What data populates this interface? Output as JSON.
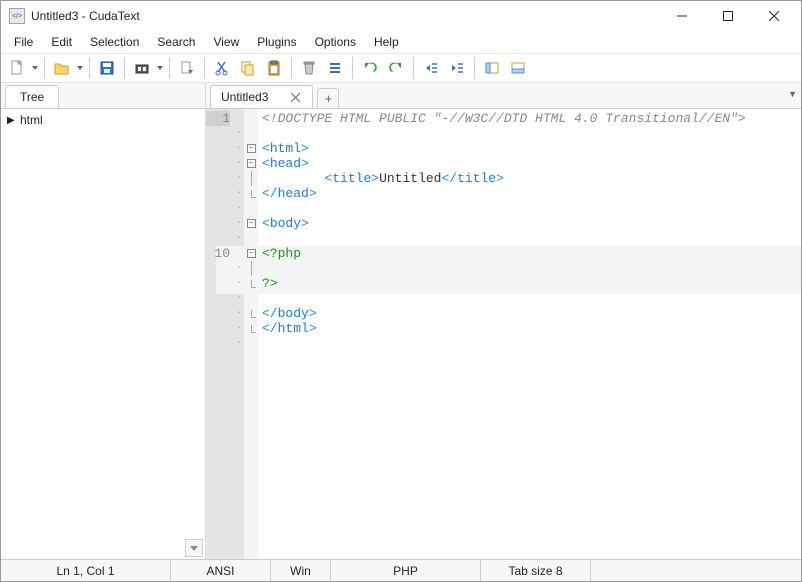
{
  "window": {
    "title": "Untitled3 - CudaText",
    "app_icon_label": "</>"
  },
  "menu": {
    "items": [
      "File",
      "Edit",
      "Selection",
      "Search",
      "View",
      "Plugins",
      "Options",
      "Help"
    ]
  },
  "toolbar_icons": {
    "new": "new-file-icon",
    "open": "open-folder-icon",
    "save": "save-icon",
    "browse": "folder-browse-icon",
    "reload": "reload-icon",
    "cut": "cut-icon",
    "copy": "copy-icon",
    "paste": "paste-icon",
    "delete": "delete-icon",
    "select_all": "select-all-icon",
    "undo": "undo-icon",
    "redo": "redo-icon",
    "indent": "unindent-icon",
    "outdent": "indent-icon",
    "panel1": "side-panel-icon",
    "panel2": "bottom-panel-icon"
  },
  "side_panel": {
    "tab_label": "Tree",
    "items": [
      {
        "label": "html"
      }
    ]
  },
  "editor_tabs": {
    "active": {
      "label": "Untitled3"
    },
    "new_tab_glyph": "+"
  },
  "gutter": {
    "visible_numbers": [
      "1",
      "",
      "",
      "",
      "",
      "",
      "",
      "",
      "",
      "10",
      "",
      "",
      "",
      "",
      "",
      ""
    ],
    "dots": [
      "",
      "·",
      "·",
      "·",
      "·",
      "·",
      "·",
      "·",
      "·",
      "",
      "·",
      "·",
      "·",
      "·",
      "·",
      "·"
    ]
  },
  "code": {
    "lines": [
      {
        "type": "comment",
        "text": "<!DOCTYPE HTML PUBLIC \"-//W3C//DTD HTML 4.0 Transitional//EN\">"
      },
      {
        "type": "blank",
        "text": ""
      },
      {
        "type": "tag-open",
        "indent": 0,
        "tag": "html"
      },
      {
        "type": "tag-open",
        "indent": 0,
        "tag": "head"
      },
      {
        "type": "title-line",
        "indent": 8,
        "open": "title",
        "text": "Untitled",
        "close": "title"
      },
      {
        "type": "tag-close",
        "indent": 0,
        "tag": "head"
      },
      {
        "type": "blank",
        "text": ""
      },
      {
        "type": "tag-open",
        "indent": 0,
        "tag": "body"
      },
      {
        "type": "blank",
        "text": ""
      },
      {
        "type": "php-open",
        "indent": 0,
        "text": "<?php"
      },
      {
        "type": "blank",
        "text": ""
      },
      {
        "type": "php-close",
        "indent": 0,
        "text": "?>"
      },
      {
        "type": "blank",
        "text": ""
      },
      {
        "type": "tag-close",
        "indent": 0,
        "tag": "body"
      },
      {
        "type": "tag-close",
        "indent": 0,
        "tag": "html"
      },
      {
        "type": "blank",
        "text": ""
      }
    ]
  },
  "fold_markers": [
    "",
    "",
    "box",
    "box",
    "line",
    "end",
    "",
    "box",
    "",
    "box",
    "line",
    "end",
    "",
    "end",
    "end",
    ""
  ],
  "statusbar": {
    "position": "Ln 1, Col 1",
    "encoding": "ANSI",
    "line_ending": "Win",
    "syntax": "PHP",
    "tab": "Tab size 8"
  }
}
